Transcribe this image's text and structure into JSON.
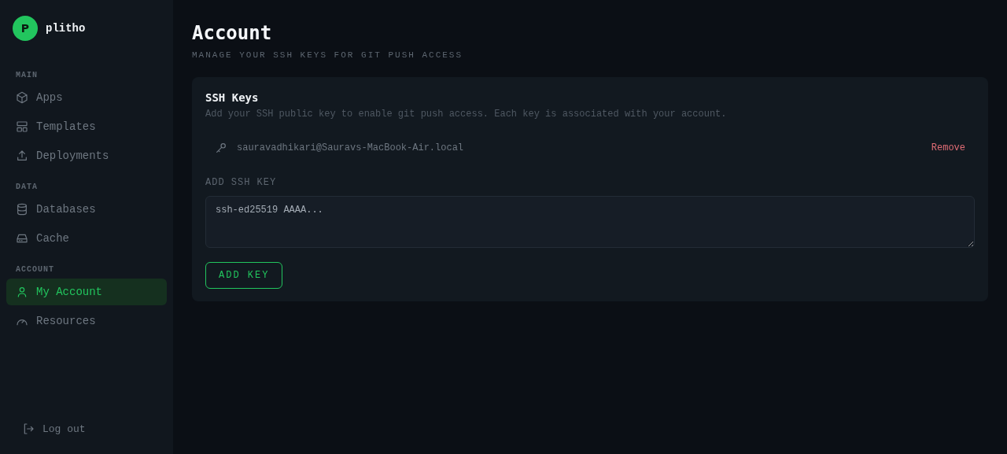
{
  "brand": {
    "initial": "P",
    "name": "plitho"
  },
  "sidebar": {
    "sections": [
      {
        "heading": "MAIN",
        "items": [
          {
            "label": "Apps",
            "selected": false
          },
          {
            "label": "Templates",
            "selected": false
          },
          {
            "label": "Deployments",
            "selected": false
          }
        ]
      },
      {
        "heading": "DATA",
        "items": [
          {
            "label": "Databases",
            "selected": false
          },
          {
            "label": "Cache",
            "selected": false
          }
        ]
      },
      {
        "heading": "ACCOUNT",
        "items": [
          {
            "label": "My Account",
            "selected": true
          },
          {
            "label": "Resources",
            "selected": false
          }
        ]
      }
    ],
    "logout": "Log out"
  },
  "page": {
    "title": "Account",
    "subtitle": "MANAGE YOUR SSH KEYS FOR GIT PUSH ACCESS"
  },
  "card": {
    "title": "SSH Keys",
    "description": "Add your SSH public key to enable git push access. Each key is associated with your account.",
    "keys": [
      {
        "name": "sauravadhikari@Sauravs-MacBook-Air.local",
        "action": "Remove"
      }
    ],
    "field_label": "ADD SSH KEY",
    "placeholder": "ssh-ed25519 AAAA...",
    "button": "ADD KEY"
  }
}
